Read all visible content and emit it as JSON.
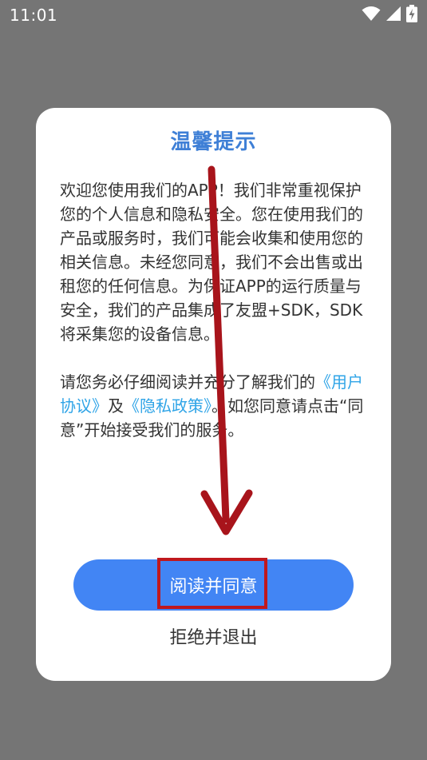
{
  "status_bar": {
    "time": "11:01",
    "icons": [
      "wifi-icon",
      "cellular-signal-icon",
      "battery-charging-icon"
    ]
  },
  "dialog": {
    "title": "温馨提示",
    "paragraph1": "欢迎您使用我们的APP！我们非常重视保护您的个人信息和隐私安全。您在使用我们的产品或服务时，我们可能会收集和使用您的相关信息。未经您同意，我们不会出售或出租您的任何信息。为保证APP的运行质量与安全，我们的产品集成了友盟+SDK，SDK将采集您的设备信息。",
    "p2_before": "请您务必仔细阅读并充分了解我们的",
    "user_agreement_link": "《用户协议》",
    "p2_and": "及",
    "privacy_policy_link": "《隐私政策》",
    "p2_after": "。如您同意请点击“同意”开始接受我们的服务。",
    "agree_label": "阅读并同意",
    "reject_label": "拒绝并退出"
  },
  "colors": {
    "accent_title": "#3e7fd6",
    "button_blue": "#4285f4",
    "link_blue": "#2fa4e7",
    "annotation_red": "#c0181d",
    "scrim": "#757575"
  }
}
